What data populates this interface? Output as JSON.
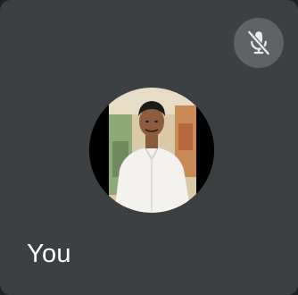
{
  "participant": {
    "name": "You",
    "mic_state": "muted",
    "mic_icon": "mic-off-icon"
  },
  "colors": {
    "tile_background": "#3c4043",
    "mute_button_background": "#5f6368",
    "name_text": "#ffffff"
  }
}
